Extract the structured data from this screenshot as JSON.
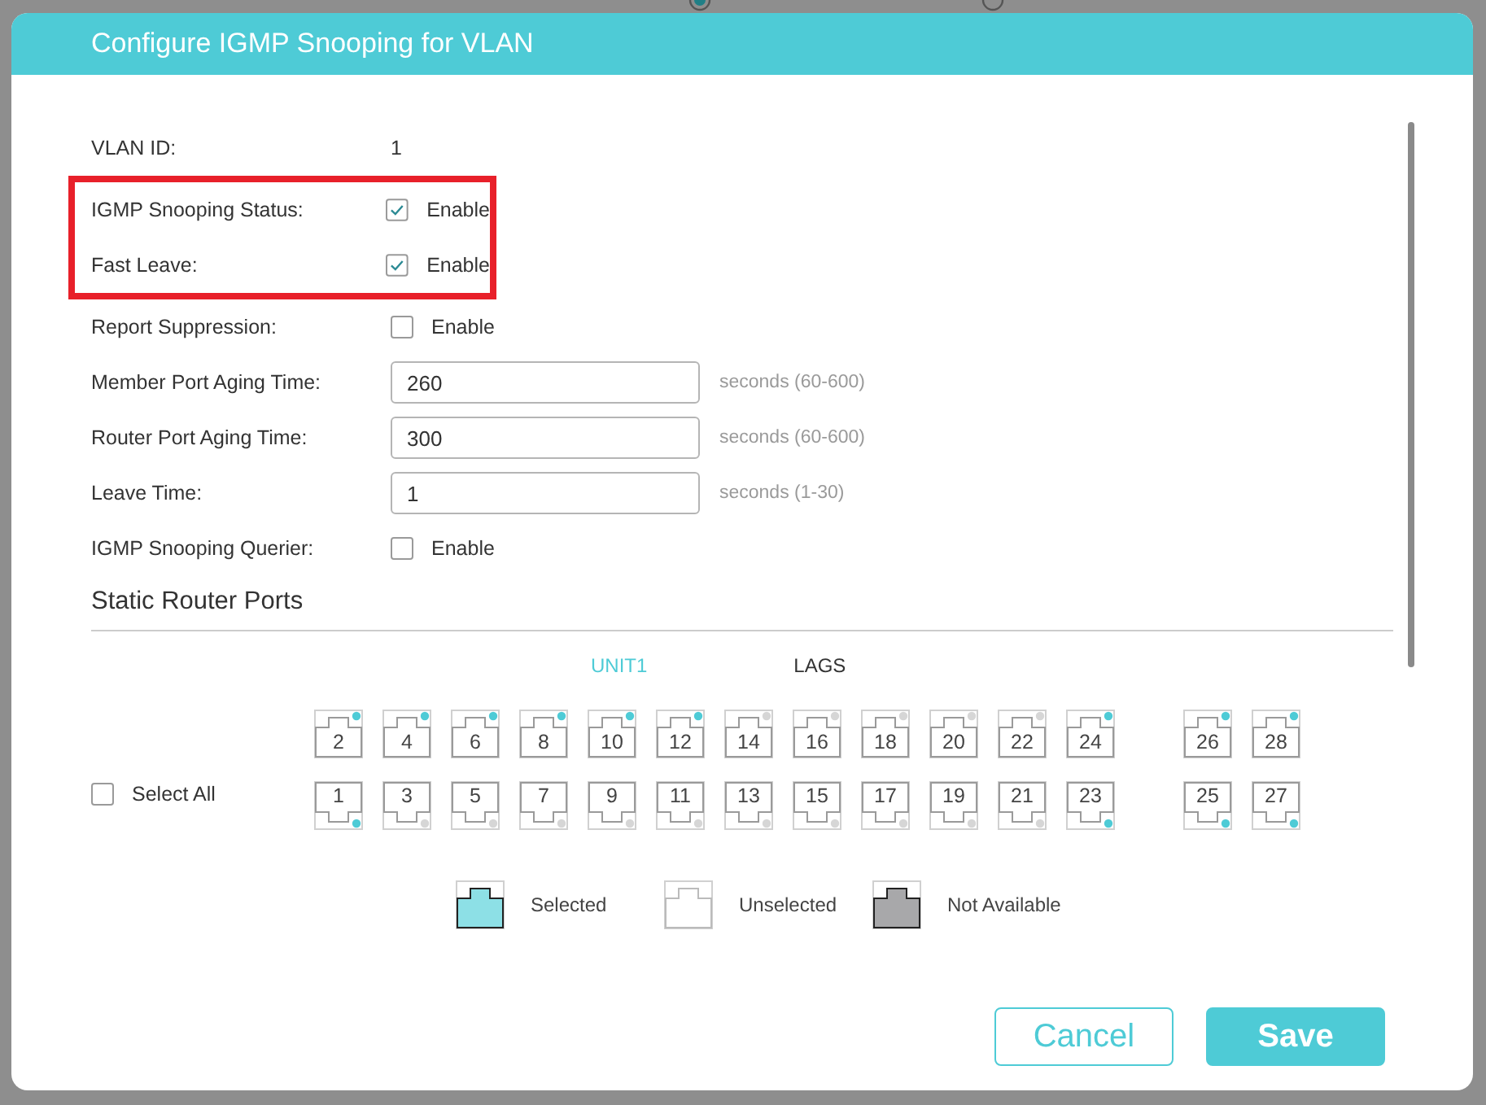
{
  "background_form": {
    "options": [
      {
        "selected": true
      },
      {
        "selected": false
      }
    ]
  },
  "dialog": {
    "title": "Configure IGMP Snooping for VLAN"
  },
  "fields": [
    {
      "kind": "text",
      "label": "VLAN ID:",
      "value": "1",
      "highlighted": false
    },
    {
      "kind": "checkbox",
      "label": "IGMP Snooping Status:",
      "option": "Enable",
      "checked": true,
      "highlighted": true
    },
    {
      "kind": "checkbox",
      "label": "Fast Leave:",
      "option": "Enable",
      "checked": true,
      "highlighted": true
    },
    {
      "kind": "checkbox",
      "label": "Report Suppression:",
      "option": "Enable",
      "checked": false,
      "highlighted": false
    },
    {
      "kind": "input",
      "label": "Member Port Aging Time:",
      "value": "260",
      "hint": "seconds (60-600)",
      "highlighted": false
    },
    {
      "kind": "input",
      "label": "Router Port Aging Time:",
      "value": "300",
      "hint": "seconds (60-600)",
      "highlighted": false
    },
    {
      "kind": "input",
      "label": "Leave Time:",
      "value": "1",
      "hint": "seconds (1-30)",
      "highlighted": false
    },
    {
      "kind": "checkbox",
      "label": "IGMP Snooping Querier:",
      "option": "Enable",
      "checked": false,
      "highlighted": false
    }
  ],
  "section": {
    "title": "Static Router Ports"
  },
  "tabs": [
    {
      "label": "UNIT1",
      "selected": true
    },
    {
      "label": "LAGS",
      "selected": false
    }
  ],
  "select_all": {
    "label": "Select All",
    "checked": false
  },
  "port_groups": [
    {
      "ports": [
        {
          "label": "2",
          "linked": true,
          "selected": false
        },
        {
          "label": "1",
          "linked": true,
          "selected": false
        },
        {
          "label": "4",
          "linked": true,
          "selected": false
        },
        {
          "label": "3",
          "linked": false,
          "selected": false
        },
        {
          "label": "6",
          "linked": true,
          "selected": false
        },
        {
          "label": "5",
          "linked": false,
          "selected": false
        },
        {
          "label": "8",
          "linked": true,
          "selected": false
        },
        {
          "label": "7",
          "linked": false,
          "selected": false
        },
        {
          "label": "10",
          "linked": true,
          "selected": false
        },
        {
          "label": "9",
          "linked": false,
          "selected": false
        },
        {
          "label": "12",
          "linked": true,
          "selected": false
        },
        {
          "label": "11",
          "linked": false,
          "selected": false
        },
        {
          "label": "14",
          "linked": false,
          "selected": false
        },
        {
          "label": "13",
          "linked": false,
          "selected": false
        },
        {
          "label": "16",
          "linked": false,
          "selected": false
        },
        {
          "label": "15",
          "linked": false,
          "selected": false
        },
        {
          "label": "18",
          "linked": false,
          "selected": false
        },
        {
          "label": "17",
          "linked": false,
          "selected": false
        },
        {
          "label": "20",
          "linked": false,
          "selected": false
        },
        {
          "label": "19",
          "linked": false,
          "selected": false
        },
        {
          "label": "22",
          "linked": false,
          "selected": false
        },
        {
          "label": "21",
          "linked": false,
          "selected": false
        },
        {
          "label": "24",
          "linked": true,
          "selected": false
        },
        {
          "label": "23",
          "linked": true,
          "selected": false
        }
      ]
    },
    {
      "ports": [
        {
          "label": "26",
          "linked": true,
          "selected": false
        },
        {
          "label": "25",
          "linked": true,
          "selected": false
        },
        {
          "label": "28",
          "linked": true,
          "selected": false
        },
        {
          "label": "27",
          "linked": true,
          "selected": false
        }
      ]
    }
  ],
  "legend": [
    {
      "kind": "selected",
      "label": "Selected"
    },
    {
      "kind": "unselected",
      "label": "Unselected"
    },
    {
      "kind": "not_available",
      "label": "Not Available"
    }
  ],
  "buttons": [
    {
      "kind": "secondary",
      "label": "Cancel"
    },
    {
      "kind": "primary",
      "label": "Save"
    }
  ]
}
